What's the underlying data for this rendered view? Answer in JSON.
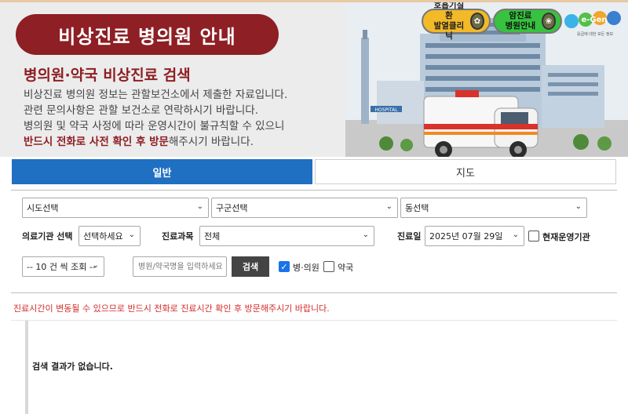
{
  "banner": {
    "title": "비상진료 병의원 안내",
    "subtitle": "병의원·약국 비상진료 검색",
    "line1": "비상진료 병의원 정보는 관할보건소에서 제출한 자료입니다.",
    "line2": "관련 문의사항은 관할 보건소로 연락하시기 바랍니다.",
    "line3": "병의원 및 약국 사정에 따라 운영시간이 불규칙할 수 있으니",
    "line4_emph": "반드시 전화로 사전 확인 후 방문",
    "line4_rest": "해주시기 바랍니다.",
    "quick1_line1": "호흡기질환",
    "quick1_line2": "발열클리닉",
    "quick2_line1": "암진료",
    "quick2_line2": "병원안내",
    "logo_text": "e-Gen",
    "logo_tagline": "응급에 대한 모든 정보",
    "sign_text": "HOSPITAL"
  },
  "tabs": {
    "general": "일반",
    "map": "지도"
  },
  "search": {
    "sido": "시도선택",
    "gugun": "구군선택",
    "dong": "동선택",
    "institution_label": "의료기관 선택",
    "institution_value": "선택하세요",
    "department_label": "진료과목",
    "department_value": "전체",
    "date_label": "진료일",
    "date_value": "2025년 07월 29일",
    "open_now_label": "현재운영기관",
    "page_size": "-- 10 건 씩 조회 --",
    "keyword_placeholder": "병원/약국명을 입력하세요",
    "search_button": "검색",
    "hospital_label": "병·의원",
    "pharmacy_label": "약국"
  },
  "notice": "진료시간이 변동될 수 있으므로 반드시 전화로 진료시간 확인 후 방문해주시기 바랍니다.",
  "results": {
    "empty": "검색 결과가 없습니다."
  },
  "colors": {
    "brand": "#8e1f24",
    "tab_active": "#1f6fc2",
    "notice": "#d42b2b"
  }
}
